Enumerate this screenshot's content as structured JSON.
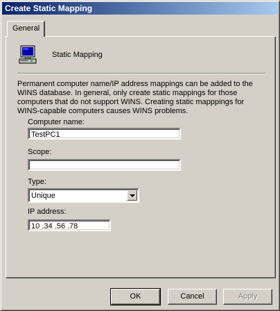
{
  "window": {
    "title": "Create Static Mapping"
  },
  "tabs": [
    {
      "label": "General"
    }
  ],
  "header": {
    "title": "Static Mapping",
    "icon": "computer-icon"
  },
  "description": "Permanent computer name/IP address mappings can be added to the WINS database. In general, only create static mappings for those computers that do not support WINS. Creating static mapppings for WINS-capable computers causes WINS problems.",
  "form": {
    "computer_name": {
      "label": "Computer name:",
      "value": "TestPC1"
    },
    "scope": {
      "label": "Scope:",
      "value": ""
    },
    "type": {
      "label": "Type:",
      "value": "Unique"
    },
    "ip_address": {
      "label": "IP address:",
      "value": "10 .34 .56 .78"
    }
  },
  "buttons": {
    "ok": "OK",
    "cancel": "Cancel",
    "apply": "Apply"
  },
  "colors": {
    "titlebar_start": "#0a246a",
    "titlebar_end": "#a6caf0",
    "face": "#d4d0c8"
  }
}
